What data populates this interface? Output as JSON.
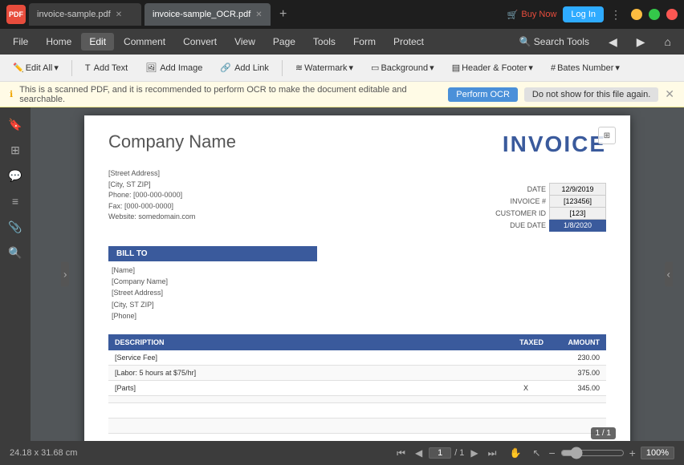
{
  "titlebar": {
    "app_icon": "PDF",
    "tabs": [
      {
        "label": "invoice-sample.pdf",
        "active": false
      },
      {
        "label": "invoice-sample_OCR.pdf",
        "active": true
      }
    ],
    "buy_now": "Buy Now",
    "login": "Log In"
  },
  "menubar": {
    "items": [
      "File",
      "Home",
      "Edit",
      "Comment",
      "Convert",
      "View",
      "Page",
      "Tools",
      "Form",
      "Protect"
    ]
  },
  "toolbar": {
    "edit_all": "Edit All",
    "edit_chevron": "▾",
    "add_text": "Add Text",
    "add_image": "Add Image",
    "add_link": "Add Link",
    "watermark": "Watermark",
    "watermark_chevron": "▾",
    "background": "Background",
    "background_chevron": "▾",
    "header_footer": "Header & Footer",
    "header_footer_chevron": "▾",
    "bates_number": "Bates Number",
    "bates_number_chevron": "▾"
  },
  "notification": {
    "message": "This is a scanned PDF, and it is recommended to perform OCR to make the document editable and searchable.",
    "ocr_btn": "Perform OCR",
    "dismiss_btn": "Do not show for this file again."
  },
  "pdf": {
    "company_name": "Company Name",
    "invoice_title": "INVOICE",
    "address_line1": "[Street Address]",
    "address_line2": "[City, ST ZIP]",
    "phone": "Phone: [000-000-0000]",
    "fax": "Fax: [000-000-0000]",
    "website": "Website: somedomain.com",
    "meta": {
      "date_label": "DATE",
      "date_value": "12/9/2019",
      "invoice_label": "INVOICE #",
      "invoice_value": "[123456]",
      "customer_label": "CUSTOMER ID",
      "customer_value": "[123]",
      "due_label": "DUE DATE",
      "due_value": "1/8/2020"
    },
    "bill_to": {
      "header": "BILL TO",
      "name": "[Name]",
      "company": "[Company Name]",
      "address": "[Street Address]",
      "city": "[City, ST ZIP]",
      "phone": "[Phone]"
    },
    "table": {
      "headers": [
        "DESCRIPTION",
        "TAXED",
        "AMOUNT"
      ],
      "rows": [
        {
          "desc": "[Service Fee]",
          "taxed": "",
          "amount": "230.00"
        },
        {
          "desc": "[Labor: 5 hours at $75/hr]",
          "taxed": "",
          "amount": "375.00"
        },
        {
          "desc": "[Parts]",
          "taxed": "X",
          "amount": "345.00"
        },
        {
          "desc": "",
          "taxed": "",
          "amount": ""
        },
        {
          "desc": "",
          "taxed": "",
          "amount": ""
        },
        {
          "desc": "",
          "taxed": "",
          "amount": ""
        }
      ]
    }
  },
  "status_bar": {
    "dimensions": "24.18 x 31.68 cm",
    "page_current": "1",
    "page_total": "/ 1",
    "zoom_level": "100%",
    "page_badge": "1 / 1"
  },
  "icons": {
    "bookmark": "🔖",
    "hand": "✋",
    "cursor": "↖",
    "comment_bubble": "💬",
    "layers": "⊞",
    "search": "🔍",
    "page_first": "⏮",
    "page_prev": "◀",
    "page_next": "▶",
    "page_last": "⏭",
    "zoom_out": "−",
    "zoom_in": "+"
  }
}
